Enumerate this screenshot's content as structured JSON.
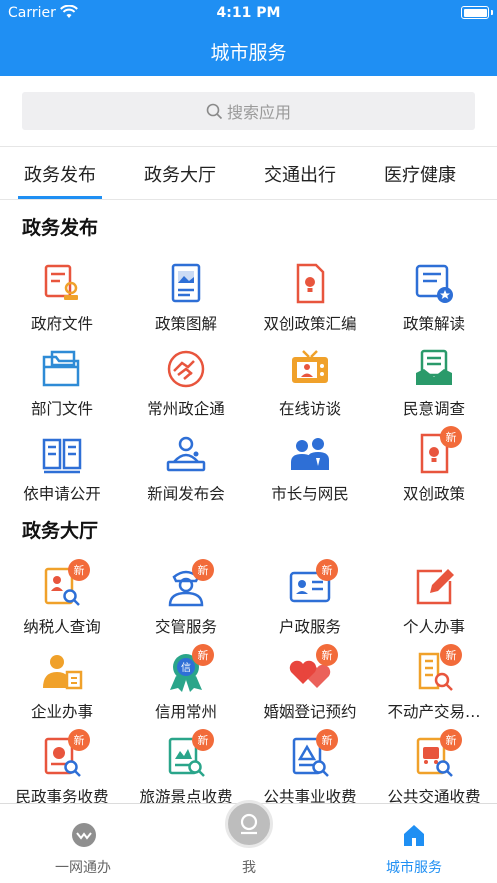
{
  "status_bar": {
    "carrier": "Carrier",
    "time": "4:11 PM"
  },
  "nav": {
    "title": "城市服务"
  },
  "search": {
    "placeholder": "搜索应用"
  },
  "tabs": [
    {
      "label": "政务发布",
      "active": true
    },
    {
      "label": "政务大厅",
      "active": false
    },
    {
      "label": "交通出行",
      "active": false
    },
    {
      "label": "医疗健康",
      "active": false
    }
  ],
  "sections": [
    {
      "title": "政务发布",
      "items": [
        {
          "label": "政府文件",
          "icon": "document-seal-icon",
          "color": "#e8553d",
          "badge": ""
        },
        {
          "label": "政策图解",
          "icon": "image-document-icon",
          "color": "#2e6fd6",
          "badge": ""
        },
        {
          "label": "双创政策汇编",
          "icon": "lightbulb-document-icon",
          "color": "#e8553d",
          "badge": ""
        },
        {
          "label": "政策解读",
          "icon": "document-star-icon",
          "color": "#2e6fd6",
          "badge": ""
        },
        {
          "label": "部门文件",
          "icon": "folder-icon",
          "color": "#2e8bd6",
          "badge": ""
        },
        {
          "label": "常州政企通",
          "icon": "handshake-icon",
          "color": "#e8553d",
          "badge": ""
        },
        {
          "label": "在线访谈",
          "icon": "tv-interview-icon",
          "color": "#f0a12a",
          "badge": ""
        },
        {
          "label": "民意调查",
          "icon": "survey-icon",
          "color": "#2a9a6a",
          "badge": ""
        },
        {
          "label": "依申请公开",
          "icon": "open-book-icon",
          "color": "#2e6fd6",
          "badge": ""
        },
        {
          "label": "新闻发布会",
          "icon": "press-conference-icon",
          "color": "#2e6fd6",
          "badge": ""
        },
        {
          "label": "市长与网民",
          "icon": "people-icon",
          "color": "#2e6fd6",
          "badge": ""
        },
        {
          "label": "双创政策",
          "icon": "lightbulb-document-icon",
          "color": "#e8553d",
          "badge": "新"
        }
      ]
    },
    {
      "title": "政务大厅",
      "items": [
        {
          "label": "纳税人查询",
          "icon": "taxpayer-search-icon",
          "color": "#f0a12a",
          "badge": "新"
        },
        {
          "label": "交管服务",
          "icon": "traffic-police-icon",
          "color": "#2e6fd6",
          "badge": "新"
        },
        {
          "label": "户政服务",
          "icon": "id-card-icon",
          "color": "#2e6fd6",
          "badge": "新"
        },
        {
          "label": "个人办事",
          "icon": "edit-icon",
          "color": "#e8553d",
          "badge": ""
        },
        {
          "label": "企业办事",
          "icon": "business-person-icon",
          "color": "#f0a12a",
          "badge": ""
        },
        {
          "label": "信用常州",
          "icon": "credit-medal-icon",
          "color": "#2aa58a",
          "badge": "新"
        },
        {
          "label": "婚姻登记预约",
          "icon": "hearts-icon",
          "color": "#e8453d",
          "badge": "新"
        },
        {
          "label": "不动产交易…",
          "icon": "building-search-icon",
          "color": "#f0a12a",
          "badge": "新"
        },
        {
          "label": "民政事务收费",
          "icon": "civil-fee-icon",
          "color": "#e8553d",
          "badge": "新"
        },
        {
          "label": "旅游景点收费",
          "icon": "scenic-fee-icon",
          "color": "#2aa58a",
          "badge": "新"
        },
        {
          "label": "公共事业收费",
          "icon": "utility-fee-icon",
          "color": "#2e6fd6",
          "badge": "新"
        },
        {
          "label": "公共交通收费",
          "icon": "bus-fee-icon",
          "color": "#f0a12a",
          "badge": "新"
        }
      ]
    }
  ],
  "bottom_tabs": [
    {
      "label": "一网通办",
      "icon": "chevron-badge-icon",
      "active": false
    },
    {
      "label": "我",
      "icon": "user-face-icon",
      "active": false
    },
    {
      "label": "城市服务",
      "icon": "home-icon",
      "active": true
    }
  ]
}
